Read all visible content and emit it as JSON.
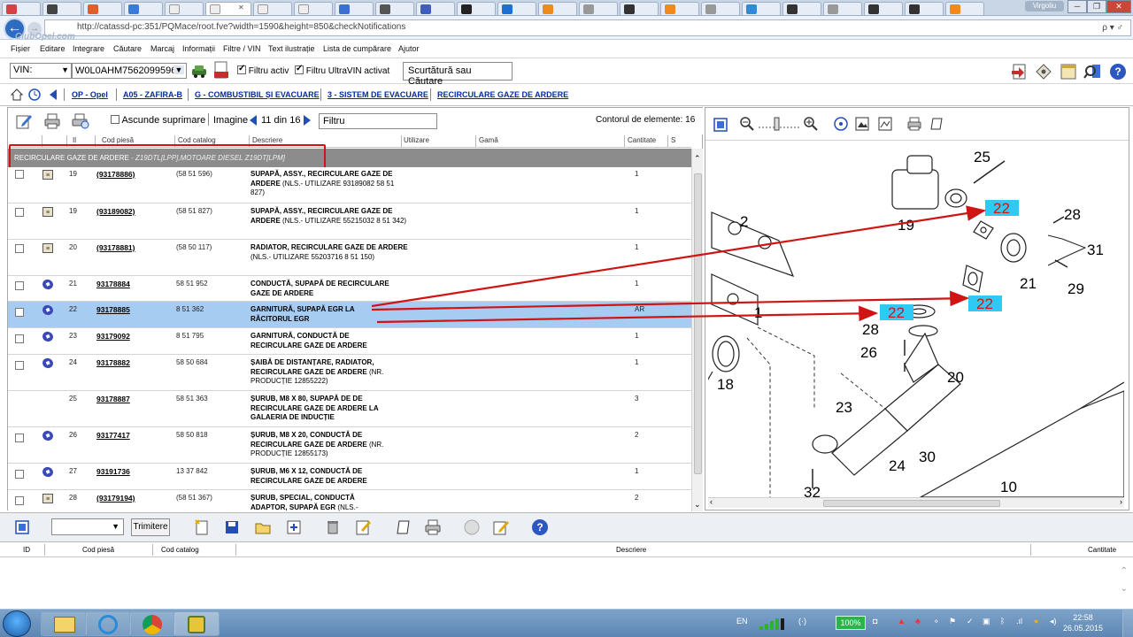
{
  "browser": {
    "url": "http://catassd-pc:351/PQMace/root.fve?width=1590&height=850&checkNotifications",
    "watermark": "ClubOpel.com",
    "user": "Virgoliu",
    "search_symbol": "ρ ▾ ♂"
  },
  "menu": {
    "items": [
      "Fișier",
      "Editare",
      "Integrare",
      "Căutare",
      "Marcaj",
      "Informații",
      "Filtre / VIN",
      "Text ilustrație",
      "Lista de cumpărare",
      "Ajutor"
    ]
  },
  "toolbar": {
    "vin_select": "VIN:",
    "vin_value": "W0L0AHM7562099596",
    "filter_active": "Filtru activ",
    "filter_ultravin": "Filtru UltraVIN activat",
    "shortcut_placeholder": "Scurtătură sau Căutare"
  },
  "breadcrumb": [
    "OP - Opel",
    "A05 - ZAFIRA-B",
    "G - COMBUSTIBIL ȘI EVACUARE",
    "3 - SISTEM DE EVACUARE",
    "RECIRCULARE GAZE DE ARDERE"
  ],
  "list_toolbar": {
    "hide_label": "Ascunde suprimare",
    "image_label": "Imagine",
    "image_counter": "11 din 16",
    "filter_placeholder": "Filtru",
    "element_count": "Contorul de elemente: 16"
  },
  "columns": {
    "il": "Il",
    "cod_piesa": "Cod piesă",
    "cod_catalog": "Cod catalog",
    "descriere": "Descriere",
    "utilizare": "Utilizare",
    "gama": "Gamă",
    "cantitate": "Cantitate",
    "s": "S"
  },
  "group": {
    "title": "RECIRCULARE GAZE DE ARDERE",
    "subtitle": "- Z19DTL[LPP],MOTOARE DIESEL Z19DT[LPM]"
  },
  "rows": [
    {
      "il": "19",
      "part": "(93178886)",
      "catalog": "(58 51 596)",
      "desc": "SUPAPĂ, ASSY., RECIRCULARE GAZE DE ARDERE",
      "note": "(NLS.- UTILIZARE 93189082 58 51 827)",
      "qty": "1",
      "icon": "book"
    },
    {
      "il": "19",
      "part": "(93189082)",
      "catalog": "(58 51 827)",
      "desc": "SUPAPĂ, ASSY., RECIRCULARE GAZE DE ARDERE",
      "note": "(NLS.- UTILIZARE 55215032 8 51 342)",
      "qty": "1",
      "icon": "book"
    },
    {
      "il": "20",
      "part": "(93178881)",
      "catalog": "(58 50 117)",
      "desc": "RADIATOR, RECIRCULARE GAZE DE ARDERE",
      "note": "(NLS.- UTILIZARE 55203716 8 51 150)",
      "qty": "1",
      "icon": "book"
    },
    {
      "il": "21",
      "part": "93178884",
      "catalog": "58 51 952",
      "desc": "CONDUCTĂ, SUPAPĂ DE RECIRCULARE GAZE DE ARDERE",
      "note": "",
      "qty": "1",
      "icon": "badge"
    },
    {
      "il": "22",
      "part": "93178885",
      "catalog": "8 51 362",
      "desc": "GARNITURĂ, SUPAPĂ EGR LA RĂCITORUL EGR",
      "note": "",
      "qty": "AR",
      "icon": "badge"
    },
    {
      "il": "23",
      "part": "93179092",
      "catalog": "8 51 795",
      "desc": "GARNITURĂ, CONDUCTĂ DE RECIRCULARE GAZE DE ARDERE",
      "note": "",
      "qty": "1",
      "icon": "badge"
    },
    {
      "il": "24",
      "part": "93178882",
      "catalog": "58 50 684",
      "desc": "ȘAIBĂ DE DISTANȚARE, RADIATOR, RECIRCULARE GAZE DE ARDERE",
      "note": "(NR. PRODUCȚIE 12855222)",
      "qty": "1",
      "icon": "badge"
    },
    {
      "il": "25",
      "part": "93178887",
      "catalog": "58 51 363",
      "desc": "ȘURUB, M8 X 80, SUPAPĂ DE DE RECIRCULARE GAZE DE ARDERE LA GALAERIA DE INDUCȚIE",
      "note": "",
      "qty": "3",
      "icon": ""
    },
    {
      "il": "26",
      "part": "93177417",
      "catalog": "58 50 818",
      "desc": "ȘURUB, M8 X 20, CONDUCTĂ DE RECIRCULARE GAZE DE ARDERE",
      "note": "(NR. PRODUCȚIE 12855173)",
      "qty": "2",
      "icon": "badge"
    },
    {
      "il": "27",
      "part": "93191736",
      "catalog": "13 37 842",
      "desc": "ȘURUB, M6 X 12, CONDUCTĂ DE RECIRCULARE GAZE DE ARDERE",
      "note": "",
      "qty": "1",
      "icon": "badge"
    },
    {
      "il": "28",
      "part": "(93179194)",
      "catalog": "(58 51 367)",
      "desc": "ȘURUB, SPECIAL, CONDUCTĂ ADAPTOR, SUPAPĂ EGR",
      "note": "(NLS.-",
      "qty": "2",
      "icon": "book"
    }
  ],
  "diagram": {
    "callouts": [
      "25",
      "22",
      "28",
      "2",
      "19",
      "31",
      "21",
      "29",
      "22",
      "22",
      "1",
      "28",
      "26",
      "20",
      "18",
      "23",
      "24",
      "30",
      "32",
      "10"
    ]
  },
  "bottom": {
    "send_label": "Trimitere",
    "columns": [
      "ID",
      "Cod piesă",
      "Cod catalog",
      "Descriere",
      "Cantitate"
    ]
  },
  "taskbar": {
    "lang": "EN",
    "battery": "100%",
    "time": "22:58",
    "date": "26.05.2015"
  },
  "colors": {
    "selected_row": "#a7ccf1",
    "group_header": "#8c8c8c",
    "highlight_box": "#d01414",
    "callout_highlight": "#2fc9f5",
    "link": "#0b2a9a"
  }
}
